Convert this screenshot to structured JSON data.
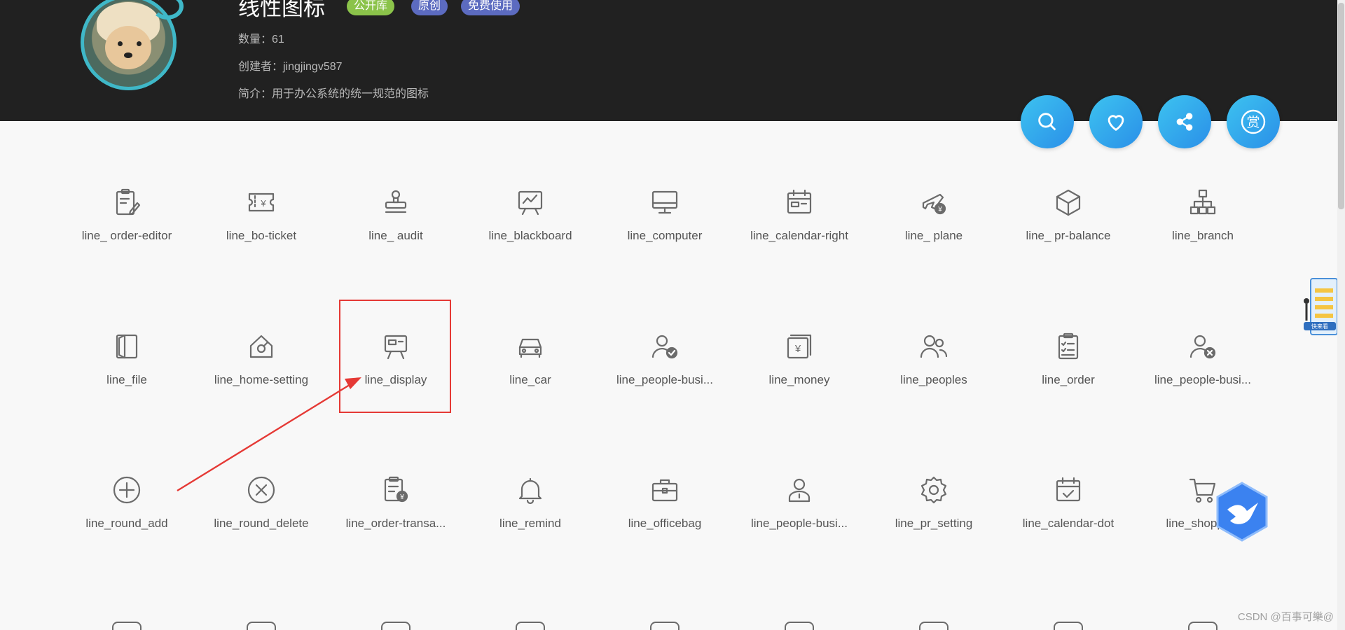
{
  "header": {
    "title": "线性图标",
    "tags": [
      "公开库",
      "原创",
      "免费使用"
    ],
    "count": "数量：61",
    "creator": "创建者：jingjingv587",
    "intro": "简介：用于办公系统的统一规范的图标",
    "tag_colors": [
      "#8bc34a",
      "#5c6bc0",
      "#5c6bc0"
    ]
  },
  "actions": {
    "search": "search-icon",
    "favorite": "heart-icon",
    "share": "share-icon",
    "reward": "赏"
  },
  "icons": [
    {
      "label": "line_ order-editor",
      "icon": "order-editor-icon"
    },
    {
      "label": "line_bo-ticket",
      "icon": "ticket-icon"
    },
    {
      "label": "line_ audit",
      "icon": "stamp-icon"
    },
    {
      "label": "line_blackboard",
      "icon": "blackboard-icon"
    },
    {
      "label": "line_computer",
      "icon": "computer-icon"
    },
    {
      "label": "line_calendar-right",
      "icon": "calendar-icon"
    },
    {
      "label": "line_ plane",
      "icon": "plane-icon"
    },
    {
      "label": "line_ pr-balance",
      "icon": "cube-icon"
    },
    {
      "label": "line_branch",
      "icon": "branch-icon"
    },
    {
      "label": "line_file",
      "icon": "file-icon"
    },
    {
      "label": "line_home-setting",
      "icon": "home-setting-icon"
    },
    {
      "label": "line_display",
      "icon": "display-icon"
    },
    {
      "label": "line_car",
      "icon": "car-icon"
    },
    {
      "label": "line_people-busi...",
      "icon": "people-check-icon"
    },
    {
      "label": "line_money",
      "icon": "money-icon"
    },
    {
      "label": "line_peoples",
      "icon": "peoples-icon"
    },
    {
      "label": "line_order",
      "icon": "order-icon"
    },
    {
      "label": "line_people-busi...",
      "icon": "people-close-icon"
    },
    {
      "label": "line_round_add",
      "icon": "round-add-icon"
    },
    {
      "label": "line_round_delete",
      "icon": "round-delete-icon"
    },
    {
      "label": "line_order-transa...",
      "icon": "order-transaction-icon"
    },
    {
      "label": "line_remind",
      "icon": "bell-icon"
    },
    {
      "label": "line_officebag",
      "icon": "briefcase-icon"
    },
    {
      "label": "line_people-busi...",
      "icon": "people-business-icon"
    },
    {
      "label": "line_pr_setting",
      "icon": "gear-icon"
    },
    {
      "label": "line_calendar-dot",
      "icon": "calendar-check-icon"
    },
    {
      "label": "line_shopping",
      "icon": "shopping-cart-icon"
    }
  ],
  "watermark": "CSDN @百事可樂@",
  "side_widget": "快来看"
}
